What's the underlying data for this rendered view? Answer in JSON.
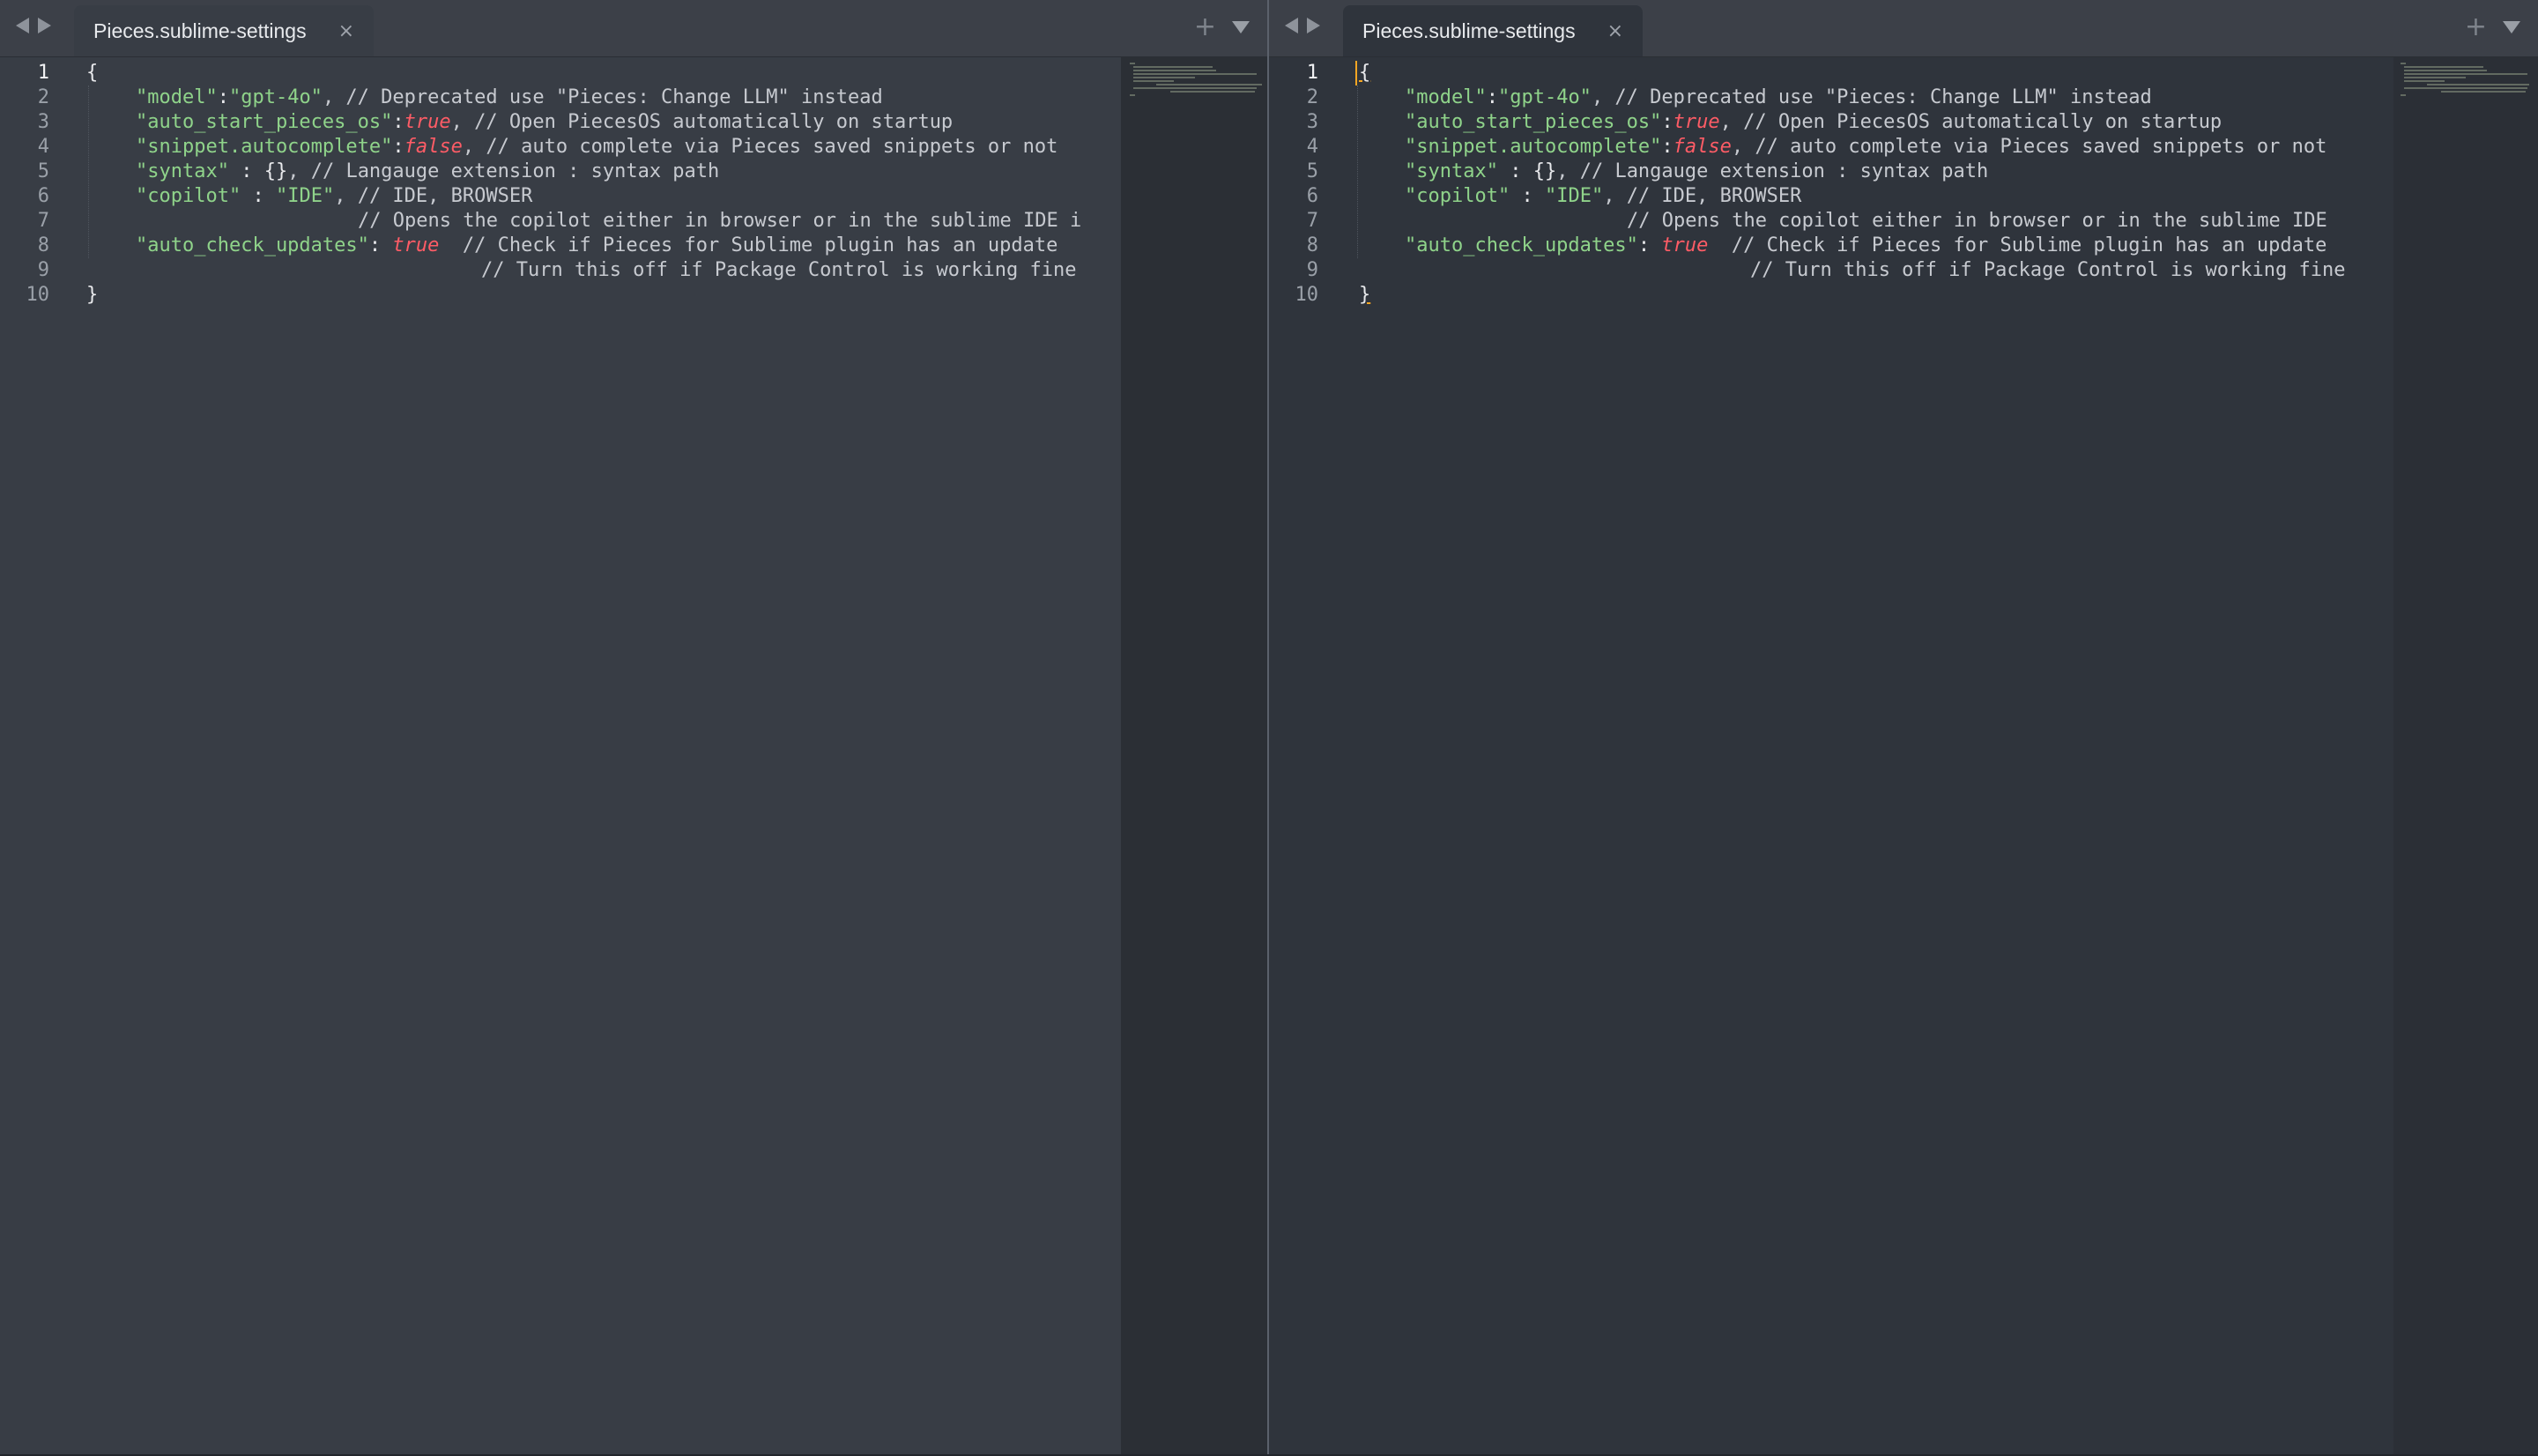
{
  "colors": {
    "background": "#2f343c",
    "tab_bar": "#3c4048",
    "string": "#8fd38a",
    "boolean": "#ff5c66",
    "comment": "#c7cad0",
    "caret": "#f5a623"
  },
  "icons": {
    "nav_back": "triangle-left-icon",
    "nav_forward": "triangle-right-icon",
    "close": "close-icon",
    "new_tab": "plus-icon",
    "tab_menu": "caret-down-icon"
  },
  "panes": {
    "left": {
      "tab": {
        "label": "Pieces.sublime-settings",
        "close": "×"
      },
      "tools": {
        "plus": "+"
      }
    },
    "right": {
      "tab": {
        "label": "Pieces.sublime-settings",
        "close": "×"
      },
      "tools": {
        "plus": "+"
      }
    }
  },
  "file": {
    "line_numbers": [
      "1",
      "2",
      "3",
      "4",
      "5",
      "6",
      "7",
      "8",
      "9",
      "10"
    ],
    "lines": {
      "l1": {
        "brace": "{"
      },
      "l2": {
        "key": "\"model\"",
        "sep": ":",
        "value": "\"gpt-4o\"",
        "comment": ", // Deprecated use \"Pieces: Change LLM\" instead"
      },
      "l3": {
        "key": "\"auto_start_pieces_os\"",
        "sep": ":",
        "value": "true",
        "comment": ", // Open PiecesOS automatically on startup"
      },
      "l4": {
        "key": "\"snippet.autocomplete\"",
        "sep": ":",
        "value": "false",
        "comment": ", // auto complete via Pieces saved snippets or not"
      },
      "l5": {
        "key": "\"syntax\"",
        "sep": " : ",
        "value": "{}",
        "comment": ", // Langauge extension : syntax path"
      },
      "l6": {
        "key": "\"copilot\"",
        "sep": " : ",
        "value": "\"IDE\"",
        "comment": ", // IDE, BROWSER"
      },
      "l7": {
        "comment": "// Opens the copilot either in browser or in the sublime IDE i"
      },
      "l8": {
        "key": "\"auto_check_updates\"",
        "sep": ": ",
        "value": "true",
        "comment": "  // Check if Pieces for Sublime plugin has an update"
      },
      "l9": {
        "comment": "// Turn this off if Package Control is working fine"
      },
      "l10": {
        "brace": "}"
      }
    },
    "right_pane_line7_comment": "// Opens the copilot either in browser or in the sublime IDE"
  }
}
